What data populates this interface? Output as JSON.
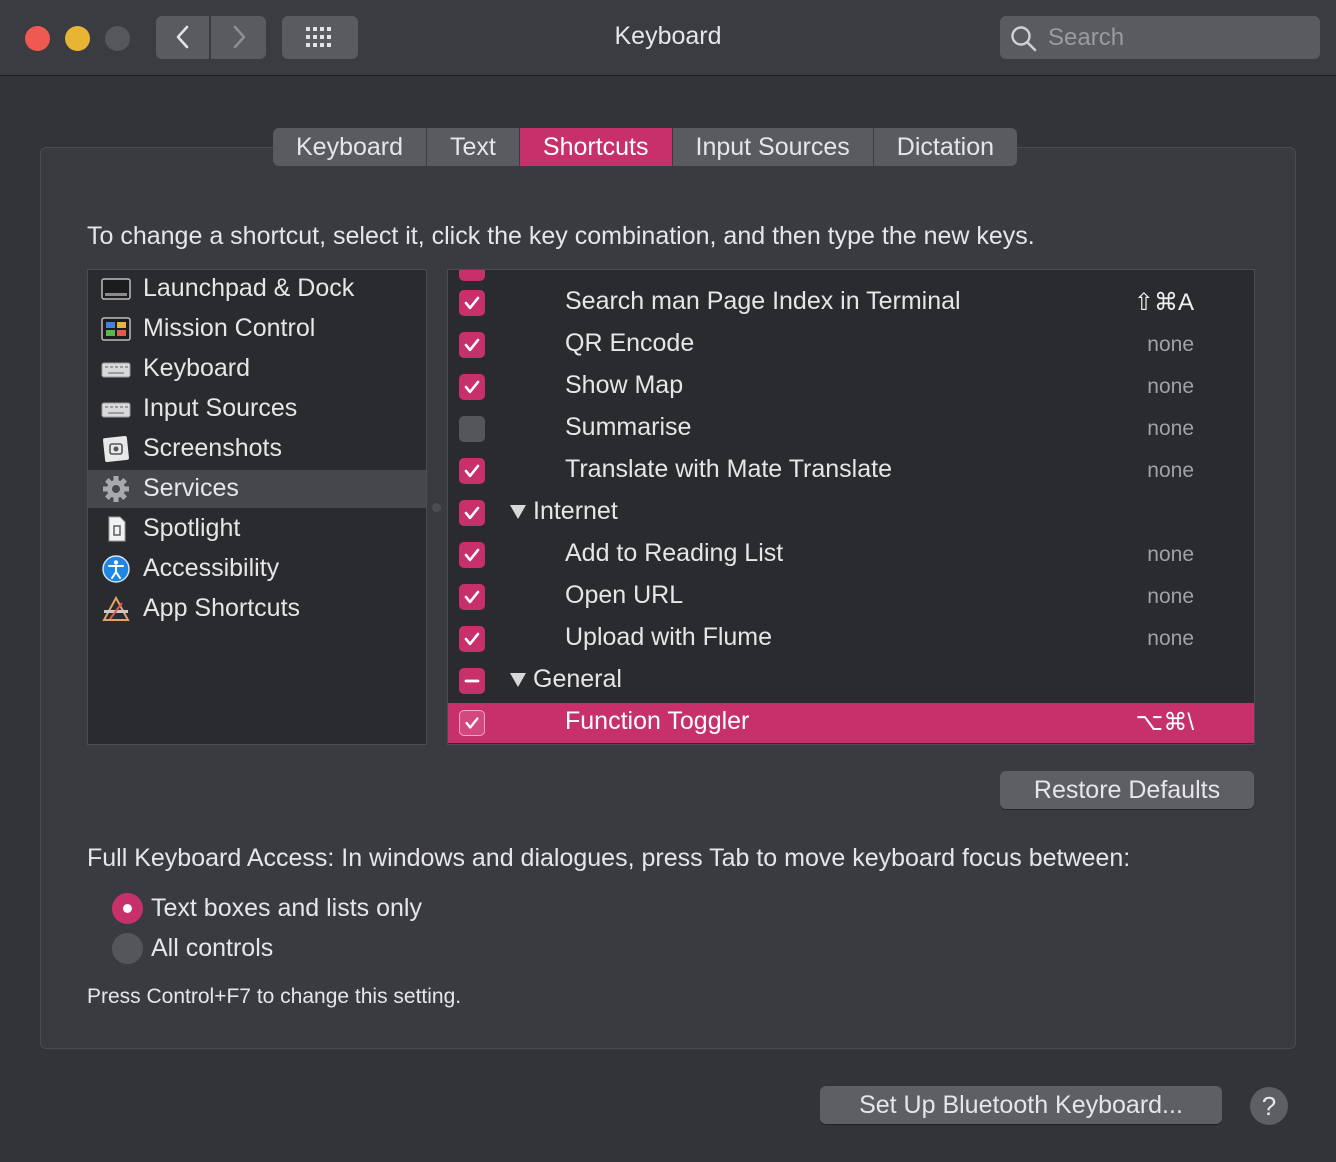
{
  "window": {
    "title": "Keyboard",
    "search_placeholder": "Search"
  },
  "tabs": [
    {
      "label": "Keyboard",
      "active": false
    },
    {
      "label": "Text",
      "active": false
    },
    {
      "label": "Shortcuts",
      "active": true
    },
    {
      "label": "Input Sources",
      "active": false
    },
    {
      "label": "Dictation",
      "active": false
    }
  ],
  "instruction": "To change a shortcut, select it, click the key combination, and then type the new keys.",
  "categories": [
    {
      "label": "Launchpad & Dock",
      "icon": "launchpad-dock-icon"
    },
    {
      "label": "Mission Control",
      "icon": "mission-control-icon"
    },
    {
      "label": "Keyboard",
      "icon": "keyboard-icon"
    },
    {
      "label": "Input Sources",
      "icon": "input-sources-icon"
    },
    {
      "label": "Screenshots",
      "icon": "screenshots-icon"
    },
    {
      "label": "Services",
      "icon": "gear-icon",
      "selected": true
    },
    {
      "label": "Spotlight",
      "icon": "spotlight-icon"
    },
    {
      "label": "Accessibility",
      "icon": "accessibility-icon"
    },
    {
      "label": "App Shortcuts",
      "icon": "app-shortcuts-icon"
    }
  ],
  "services": [
    {
      "label": "Search man Page Index in Terminal",
      "checked": true,
      "shortcut": "⇧⌘A",
      "kind": "item"
    },
    {
      "label": "QR Encode",
      "checked": true,
      "shortcut": "none",
      "kind": "item"
    },
    {
      "label": "Show Map",
      "checked": true,
      "shortcut": "none",
      "kind": "item"
    },
    {
      "label": "Summarise",
      "checked": false,
      "shortcut": "none",
      "kind": "item"
    },
    {
      "label": "Translate with Mate Translate",
      "checked": true,
      "shortcut": "none",
      "kind": "item"
    },
    {
      "label": "Internet",
      "checked": true,
      "shortcut": "",
      "kind": "group"
    },
    {
      "label": "Add to Reading List",
      "checked": true,
      "shortcut": "none",
      "kind": "item"
    },
    {
      "label": "Open URL",
      "checked": true,
      "shortcut": "none",
      "kind": "item"
    },
    {
      "label": "Upload with Flume",
      "checked": true,
      "shortcut": "none",
      "kind": "item"
    },
    {
      "label": "General",
      "checked": "mixed",
      "shortcut": "",
      "kind": "group"
    },
    {
      "label": "Function Toggler",
      "checked": true,
      "shortcut": "⌥⌘\\",
      "kind": "item",
      "selected": true
    }
  ],
  "buttons": {
    "restore_defaults": "Restore Defaults",
    "bluetooth": "Set Up Bluetooth Keyboard...",
    "help": "?"
  },
  "full_keyboard_access": {
    "label": "Full Keyboard Access: In windows and dialogues, press Tab to move keyboard focus between:",
    "options": [
      {
        "label": "Text boxes and lists only",
        "selected": true
      },
      {
        "label": "All controls",
        "selected": false
      }
    ],
    "note": "Press Control+F7 to change this setting."
  },
  "colors": {
    "accent": "#c8306c",
    "window_bg": "#333439",
    "list_bg": "#2a2b2f"
  }
}
